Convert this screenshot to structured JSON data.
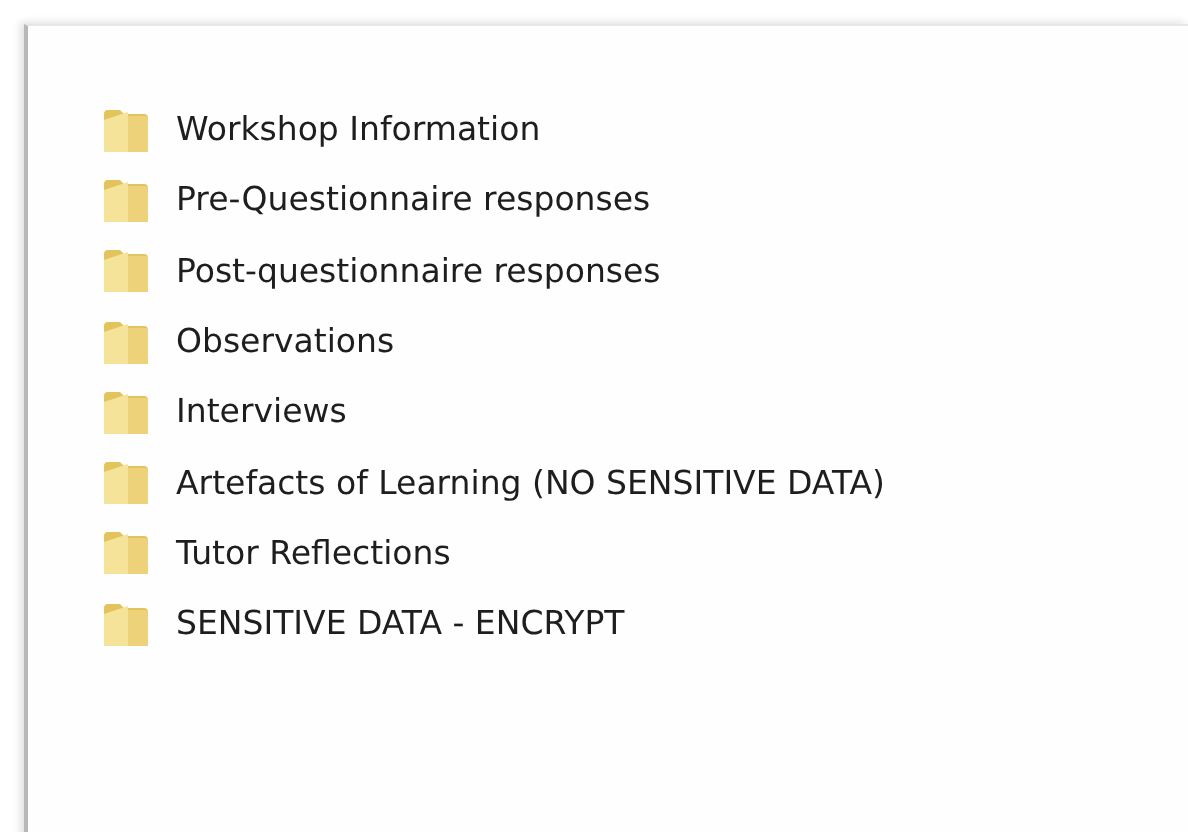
{
  "folders": [
    {
      "name": "Workshop Information"
    },
    {
      "name": "Pre-Questionnaire responses"
    },
    {
      "name": "Post-questionnaire responses"
    },
    {
      "name": "Observations"
    },
    {
      "name": "Interviews"
    },
    {
      "name": "Artefacts of Learning (NO SENSITIVE DATA)"
    },
    {
      "name": "Tutor Reflections"
    },
    {
      "name": "SENSITIVE DATA - ENCRYPT"
    }
  ]
}
